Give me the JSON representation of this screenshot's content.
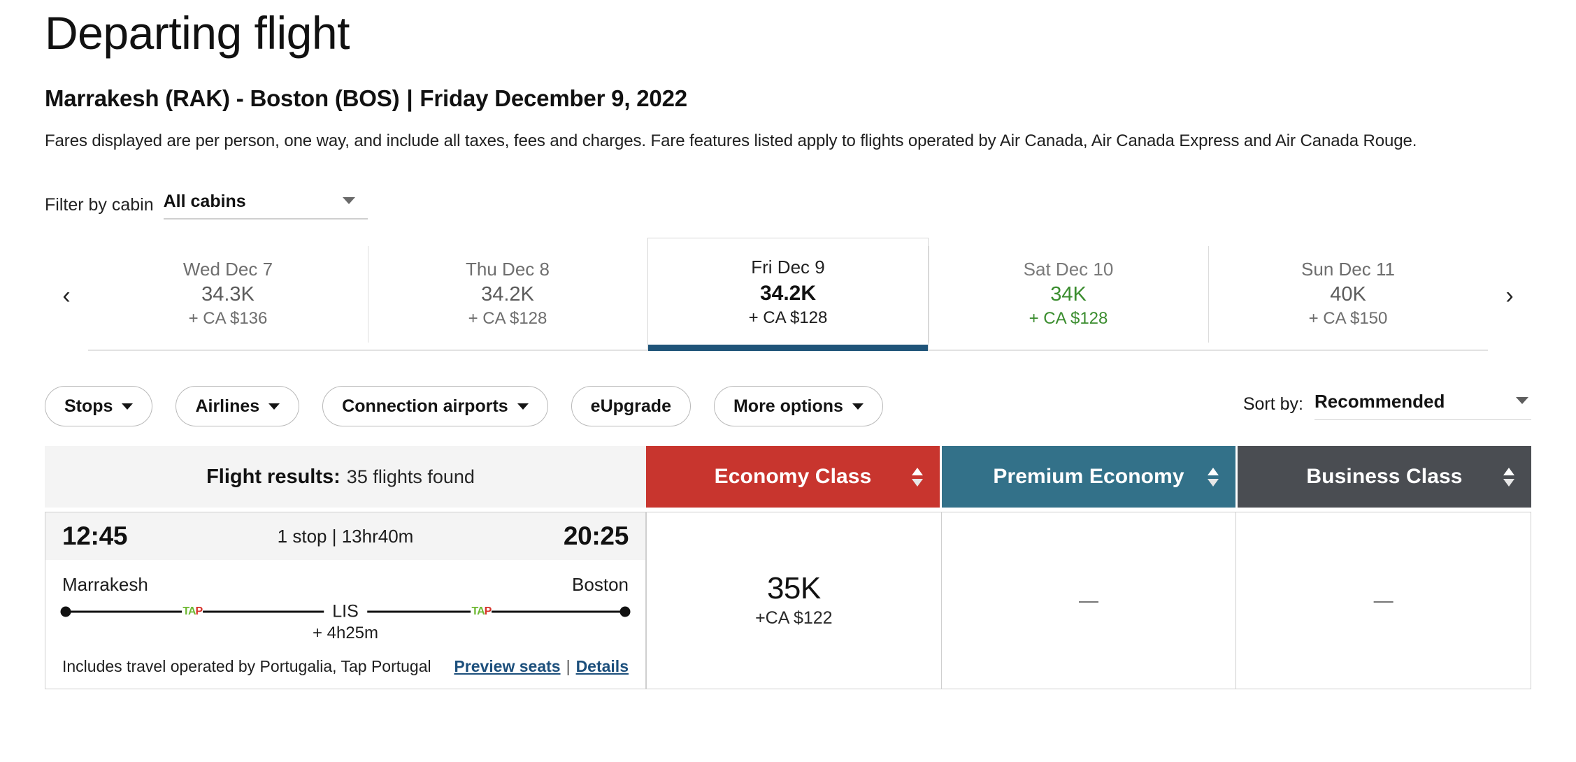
{
  "header": {
    "title": "Departing flight",
    "route_origin": "Marrakesh (RAK) - Boston (BOS)",
    "route_separator": "|",
    "route_date": "Friday December 9, 2022",
    "fares_note": "Fares displayed are per person, one way, and include all taxes, fees and charges. Fare features listed apply to flights operated by Air Canada, Air Canada Express and Air Canada Rouge."
  },
  "cabin_filter": {
    "label": "Filter by cabin",
    "value": "All cabins",
    "caret_icon": "chevron-down-icon"
  },
  "date_strip": {
    "prev_icon": "chevron-left-icon",
    "prev_glyph": "‹",
    "next_icon": "chevron-right-icon",
    "next_glyph": "›",
    "dates": [
      {
        "day": "Wed Dec 7",
        "points": "34.3K",
        "cash": "+ CA $136",
        "selected": false,
        "cheapest": false
      },
      {
        "day": "Thu Dec 8",
        "points": "34.2K",
        "cash": "+ CA $128",
        "selected": false,
        "cheapest": false
      },
      {
        "day": "Fri Dec 9",
        "points": "34.2K",
        "cash": "+ CA $128",
        "selected": true,
        "cheapest": false
      },
      {
        "day": "Sat Dec 10",
        "points": "34K",
        "cash": "+ CA $128",
        "selected": false,
        "cheapest": true
      },
      {
        "day": "Sun Dec 11",
        "points": "40K",
        "cash": "+ CA $150",
        "selected": false,
        "cheapest": false
      }
    ]
  },
  "filters": {
    "pills": [
      {
        "label": "Stops",
        "has_caret": true
      },
      {
        "label": "Airlines",
        "has_caret": true
      },
      {
        "label": "Connection airports",
        "has_caret": true
      },
      {
        "label": "eUpgrade",
        "has_caret": false
      },
      {
        "label": "More options",
        "has_caret": true
      }
    ]
  },
  "sort": {
    "label": "Sort by:",
    "value": "Recommended",
    "caret_icon": "chevron-down-icon"
  },
  "results_header": {
    "title_strong": "Flight results:",
    "title_light": "35 flights found",
    "classes": [
      {
        "label": "Economy Class",
        "color": "#c8352e"
      },
      {
        "label": "Premium Economy",
        "color": "#337189"
      },
      {
        "label": "Business Class",
        "color": "#4a4d52"
      }
    ]
  },
  "flights": [
    {
      "depart_time": "12:45",
      "arrive_time": "20:25",
      "stops_duration": "1 stop | 13hr40m",
      "origin_city": "Marrakesh",
      "destination_city": "Boston",
      "connection_code": "LIS",
      "layover": "+ 4h25m",
      "carrier_marks": [
        {
          "name": "tap-air-portugal-logo",
          "green": "TA",
          "red": "P",
          "pos": 23
        },
        {
          "name": "tap-air-portugal-logo",
          "green": "TA",
          "red": "P",
          "pos": 74
        }
      ],
      "operated_note": "Includes travel operated by Portugalia, Tap Portugal",
      "preview_seats_label": "Preview seats",
      "link_separator": "|",
      "details_label": "Details",
      "fares": [
        {
          "points": "35K",
          "cash": "+CA $122",
          "available": true
        },
        {
          "points": "—",
          "cash": "",
          "available": false
        },
        {
          "points": "—",
          "cash": "",
          "available": false
        }
      ]
    }
  ],
  "colors": {
    "economy": "#c8352e",
    "premium_economy": "#337189",
    "business": "#4a4d52",
    "selected_tab_underline": "#1f5479",
    "cheapest_green": "#3b8d2f",
    "link_blue": "#1c4f7c"
  }
}
